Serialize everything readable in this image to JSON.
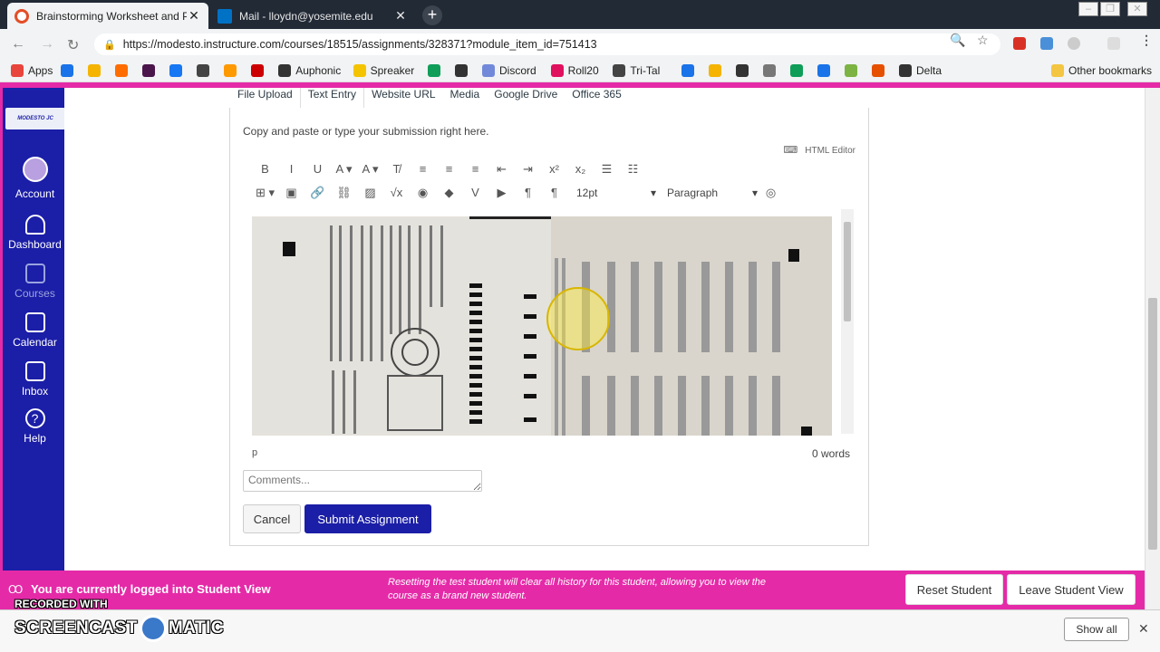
{
  "browser": {
    "tabs": [
      {
        "title": "Brainstorming Worksheet and Pr",
        "close": "✕",
        "icon_color": "#e44d26"
      },
      {
        "title": "Mail - lloydn@yosemite.edu",
        "close": "✕",
        "icon_color": "#0072c6"
      }
    ],
    "new_tab": "+",
    "window_controls": [
      "–",
      "❐",
      "✕"
    ],
    "url": "https://modesto.instructure.com/courses/18515/assignments/328371?module_item_id=751413",
    "back": "←",
    "forward": "→",
    "reload": "↻"
  },
  "bookmarks": {
    "items": [
      {
        "label": "Apps",
        "color": "#e8453c"
      },
      {
        "label": "",
        "color": "#1a73e8"
      },
      {
        "label": "",
        "color": "#f4b400"
      },
      {
        "label": "",
        "color": "#ff6d00"
      },
      {
        "label": "",
        "color": "#4a154b"
      },
      {
        "label": "",
        "color": "#1877f2"
      },
      {
        "label": "",
        "color": "#444444"
      },
      {
        "label": "",
        "color": "#ff9900"
      },
      {
        "label": "",
        "color": "#cc0000"
      },
      {
        "label": "Auphonic",
        "color": "#333333"
      },
      {
        "label": "Spreaker",
        "color": "#f5c400"
      },
      {
        "label": "",
        "color": "#0f9d58"
      },
      {
        "label": "",
        "color": "#333333"
      },
      {
        "label": "Discord",
        "color": "#7289da"
      },
      {
        "label": "Roll20",
        "color": "#e0115f"
      },
      {
        "label": "Tri-Tal",
        "color": "#444444"
      },
      {
        "label": "",
        "color": "#1a73e8"
      },
      {
        "label": "",
        "color": "#f4b400"
      },
      {
        "label": "",
        "color": "#333333"
      },
      {
        "label": "",
        "color": "#777777"
      },
      {
        "label": "",
        "color": "#0f9d58"
      },
      {
        "label": "",
        "color": "#1a73e8"
      },
      {
        "label": "",
        "color": "#7cb342"
      },
      {
        "label": "",
        "color": "#e65100"
      },
      {
        "label": "Delta",
        "color": "#333333"
      }
    ],
    "other": "Other bookmarks"
  },
  "sidebar": {
    "logo": "MODESTO JUNIOR COLLEGE",
    "items": [
      {
        "label": "Account",
        "icon": "account-icon"
      },
      {
        "label": "Dashboard",
        "icon": "dashboard-icon"
      },
      {
        "label": "Courses",
        "icon": "courses-icon"
      },
      {
        "label": "Calendar",
        "icon": "calendar-icon"
      },
      {
        "label": "Inbox",
        "icon": "inbox-icon"
      },
      {
        "label": "Help",
        "icon": "help-icon"
      }
    ]
  },
  "submission": {
    "tabs": [
      "File Upload",
      "Text Entry",
      "Website URL",
      "Media",
      "Google Drive",
      "Office 365"
    ],
    "active_tab": "Text Entry",
    "instructions": "Copy and paste or type your submission right here.",
    "html_editor": "HTML Editor",
    "font_size": "12pt",
    "block_format": "Paragraph",
    "path": "p",
    "word_count": "0 words",
    "comments_placeholder": "Comments...",
    "cancel": "Cancel",
    "submit": "Submit Assignment"
  },
  "toolbar_row1": [
    "B",
    "I",
    "U",
    "A ▾",
    "A ▾",
    "T̸",
    "≡",
    "≡",
    "≡",
    "⇤",
    "⇥",
    "x²",
    "x₂",
    "☰",
    "☷"
  ],
  "toolbar_row2": [
    "⊞ ▾",
    "▣",
    "🔗",
    "⛓",
    "▨",
    "√x",
    "◉",
    "◆",
    "V",
    "▶",
    "¶",
    "¶"
  ],
  "student_view": {
    "message": "You are currently logged into Student View",
    "info": "Resetting the test student will clear all history for this student, allowing you to view the course as a brand new student.",
    "reset": "Reset Student",
    "leave": "Leave Student View"
  },
  "watermark": {
    "line1": "RECORDED WITH",
    "line2a": "SCREENCAST",
    "line2b": "MATIC"
  },
  "downloads": {
    "show_all": "Show all",
    "close": "✕"
  }
}
